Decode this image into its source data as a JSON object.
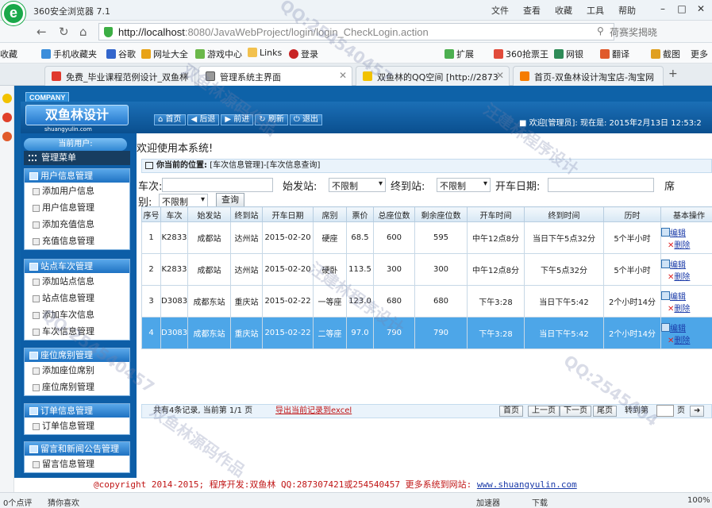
{
  "browser": {
    "app_title": "360安全浏览器 7.1",
    "title_menu": [
      "文件",
      "查看",
      "收藏",
      "工具",
      "帮助"
    ],
    "url_host": "http://localhost",
    "url_rest": ":8080/JavaWebProject/login/login_CheckLogin.action",
    "search_placeholder": "荷赛奖揭晓",
    "bookmarks": [
      "收藏",
      "手机收藏夹",
      "谷歌",
      "网址大全",
      "游戏中心",
      "Links",
      "登录",
      "扩展",
      "360抢票王",
      "网银",
      "翻译",
      "截图",
      "更多"
    ],
    "tabs": [
      "免费_毕业课程范例设计_双鱼林",
      "管理系统主界面",
      "双鱼林的QQ空间 [http://2873",
      "首页-双鱼林设计淘宝店-淘宝网"
    ],
    "status": [
      "0个点评",
      "猜你喜欢",
      "加速器",
      "下载",
      "100%"
    ],
    "colors": {
      "chrome_bg": "#eef3f7",
      "site_blue": "#0e62a8",
      "selected_row": "#4da6e8",
      "footer_red": "#c01515"
    }
  },
  "site": {
    "company_tag": "COMPANY",
    "logo": "双鱼林设计",
    "logo_sub": "shuangyulin.com",
    "nav": [
      "首页",
      "后退",
      "前进",
      "刷新",
      "退出"
    ],
    "welcome": "■ 欢迎[管理员]: 现在是: 2015年2月13日 12:53:2",
    "current_user": "当前用户:",
    "menu_title": "管理菜单",
    "menu_groups": [
      {
        "title": "用户信息管理",
        "items": [
          "添加用户信息",
          "用户信息管理",
          "添加充值信息",
          "充值信息管理"
        ]
      },
      {
        "title": "站点车次管理",
        "items": [
          "添加站点信息",
          "站点信息管理",
          "添加车次信息",
          "车次信息管理"
        ]
      },
      {
        "title": "座位席别管理",
        "items": [
          "添加座位席别",
          "座位席别管理"
        ]
      },
      {
        "title": "订单信息管理",
        "items": [
          "订单信息管理"
        ]
      },
      {
        "title": "留言和新闻公告管理",
        "items": [
          "留言信息管理"
        ]
      }
    ],
    "welcome_line": "欢迎使用本系统!",
    "location_label": "你当前的位置:",
    "location_path": "[车次信息管理]-[车次信息查询]",
    "filters": {
      "train_label": "车次:",
      "start_label": "始发站:",
      "start_value": "不限制",
      "end_label": "终到站:",
      "end_value": "不限制",
      "date_label": "开车日期:",
      "seat_label_a": "席",
      "seat_label_b": "别:",
      "seat_value": "不限制",
      "query": "查询"
    },
    "table": {
      "headers": [
        "序号",
        "车次",
        "始发站",
        "终到站",
        "开车日期",
        "席别",
        "票价",
        "总座位数",
        "剩余座位数",
        "开车时间",
        "终到时间",
        "历时",
        "基本操作"
      ],
      "rows": [
        [
          "1",
          "K2833",
          "成都站",
          "达州站",
          "2015-02-20",
          "硬座",
          "68.5",
          "600",
          "595",
          "中午12点8分",
          "当日下午5点32分",
          "5个半小时"
        ],
        [
          "2",
          "K2833",
          "成都站",
          "达州站",
          "2015-02-20",
          "硬卧",
          "113.5",
          "300",
          "300",
          "中午12点8分",
          "下午5点32分",
          "5个半小时"
        ],
        [
          "3",
          "D3083",
          "成都东站",
          "重庆站",
          "2015-02-22",
          "一等座",
          "123.0",
          "680",
          "680",
          "下午3:28",
          "当日下午5:42",
          "2个小时14分"
        ],
        [
          "4",
          "D3083",
          "成都东站",
          "重庆站",
          "2015-02-22",
          "二等座",
          "97.0",
          "790",
          "790",
          "下午3:28",
          "当日下午5:42",
          "2个小时14分"
        ]
      ],
      "op_edit": "编辑",
      "op_delete": "删除",
      "selected_row": 4
    },
    "pager": {
      "summary": "共有4条记录, 当前第 1/1 页",
      "export": "导出当前记录到excel",
      "buttons": [
        "首页",
        "上一页",
        "下一页",
        "尾页"
      ],
      "goto": "转到第",
      "page_unit": "页"
    },
    "footer": {
      "text": "@copyright 2014-2015; 程序开发:双鱼林  QQ:287307421或254540457  更多系统到网站:",
      "link": "www.shuangyulin.com"
    },
    "watermarks": [
      "QQ:254540457",
      "汪建林程序设计",
      "双鱼林源码作品",
      "QQ:254540457",
      "汪建林程序设计",
      "QQ:2545404",
      "双鱼林源码作品"
    ]
  }
}
